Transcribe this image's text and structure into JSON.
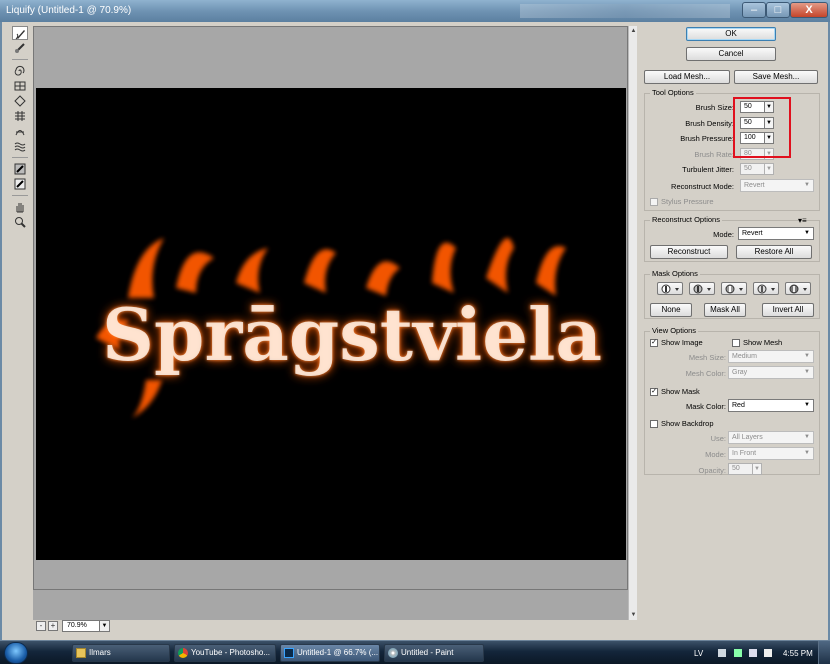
{
  "window": {
    "title": "Liquify (Untitled-1 @ 70.9%)",
    "min_label": "–",
    "max_label": "□",
    "close_label": "X"
  },
  "canvas": {
    "text": "Sprāgstviela",
    "zoom": "70.9%",
    "zoom_out": "-",
    "zoom_in": "+",
    "colors": {
      "background": "#000000",
      "glow": "#ff5a00",
      "core": "#ffffff"
    }
  },
  "tools": [
    "forward-warp-icon",
    "reconstruct-icon",
    "twirl-icon",
    "pucker-icon",
    "bloat-icon",
    "push-left-icon",
    "mirror-icon",
    "turbulence-icon",
    "freeze-mask-icon",
    "thaw-mask-icon",
    "hand-icon",
    "zoom-icon"
  ],
  "buttons": {
    "ok": "OK",
    "cancel": "Cancel",
    "load_mesh": "Load Mesh...",
    "save_mesh": "Save Mesh..."
  },
  "tool_options": {
    "title": "Tool Options",
    "brush_size_label": "Brush Size:",
    "brush_size": "50",
    "brush_density_label": "Brush Density:",
    "brush_density": "50",
    "brush_pressure_label": "Brush Pressure:",
    "brush_pressure": "100",
    "brush_rate_label": "Brush Rate:",
    "brush_rate": "80",
    "turbulent_jitter_label": "Turbulent Jitter:",
    "turbulent_jitter": "50",
    "reconstruct_mode_label": "Reconstruct Mode:",
    "reconstruct_mode": "Revert",
    "stylus_pressure": "Stylus Pressure"
  },
  "reconstruct_options": {
    "title": "Reconstruct Options",
    "mode_label": "Mode:",
    "mode": "Revert",
    "reconstruct": "Reconstruct",
    "restore_all": "Restore All"
  },
  "mask_options": {
    "title": "Mask Options",
    "icons": [
      "replace-selection-icon",
      "add-to-selection-icon",
      "subtract-from-selection-icon",
      "intersect-selection-icon",
      "invert-selection-icon"
    ],
    "none": "None",
    "mask_all": "Mask All",
    "invert_all": "Invert All"
  },
  "view_options": {
    "title": "View Options",
    "show_image": "Show Image",
    "show_mesh": "Show Mesh",
    "mesh_size_label": "Mesh Size:",
    "mesh_size": "Medium",
    "mesh_color_label": "Mesh Color:",
    "mesh_color": "Gray",
    "show_mask": "Show Mask",
    "mask_color_label": "Mask Color:",
    "mask_color": "Red",
    "show_backdrop": "Show Backdrop",
    "use_label": "Use:",
    "use": "All Layers",
    "mode_label": "Mode:",
    "mode": "In Front",
    "opacity_label": "Opacity:",
    "opacity": "50"
  },
  "taskbar": {
    "items": [
      {
        "label": "Ilmars",
        "icon": "folder-icon"
      },
      {
        "label": "YouTube - Photosho...",
        "icon": "chrome-icon"
      },
      {
        "label": "Untitled-1 @ 66.7% (...",
        "icon": "photoshop-icon"
      },
      {
        "label": "Untitled - Paint",
        "icon": "paint-icon"
      }
    ],
    "language": "LV",
    "clock": "4:55 PM"
  },
  "accent_colors": {
    "highlight": "#e0101e",
    "ok_border": "#3c7fb1"
  }
}
